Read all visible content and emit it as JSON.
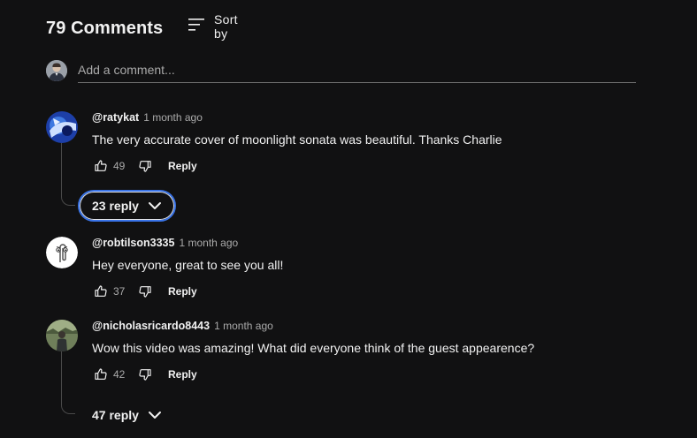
{
  "header": {
    "count_label": "79 Comments",
    "sort_label": "Sort by"
  },
  "add_comment": {
    "placeholder": "Add a comment..."
  },
  "comments": [
    {
      "author": "@ratykat",
      "time": "1 month ago",
      "text": "The very accurate cover of moonlight sonata was beautiful. Thanks Charlie",
      "likes": "49",
      "reply_label": "Reply",
      "replies_label": "23 reply"
    },
    {
      "author": "@robtilson3335",
      "time": "1 month ago",
      "text": "Hey everyone, great to see you all!",
      "likes": "37",
      "reply_label": "Reply"
    },
    {
      "author": "@nicholasricardo8443",
      "time": "1 month ago",
      "text": "Wow this video was amazing! What did everyone think of the guest appearence?",
      "likes": "42",
      "reply_label": "Reply",
      "replies_label": "47 reply"
    }
  ],
  "colors": {
    "background": "#111112",
    "focus_ring": "#3a74e8",
    "secondary_text": "#aaaaaa"
  },
  "icons": {
    "sort": "sort-lines-icon",
    "like": "thumbs-up-icon",
    "dislike": "thumbs-down-icon",
    "expand": "chevron-down-icon"
  }
}
